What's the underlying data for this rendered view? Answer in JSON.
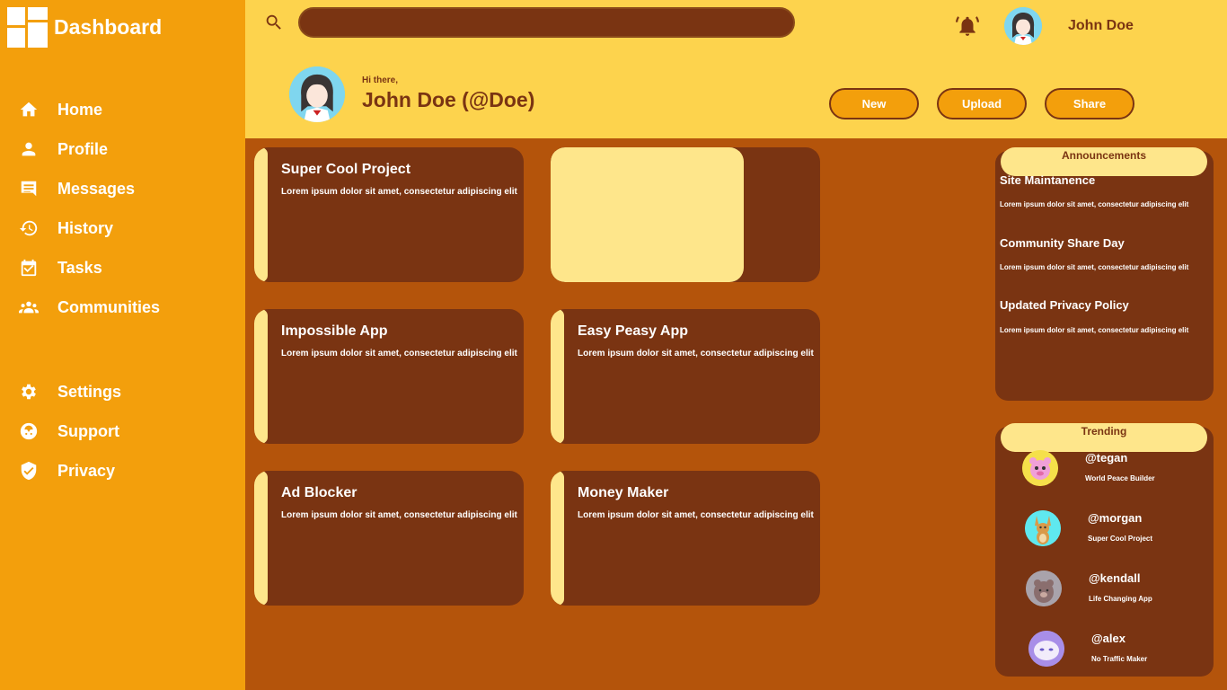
{
  "brand": {
    "title": "Dashboard"
  },
  "sidebar": {
    "items": [
      {
        "label": "Home",
        "icon": "home-icon"
      },
      {
        "label": "Profile",
        "icon": "person-icon"
      },
      {
        "label": "Messages",
        "icon": "messages-icon"
      },
      {
        "label": "History",
        "icon": "history-icon"
      },
      {
        "label": "Tasks",
        "icon": "tasks-icon"
      },
      {
        "label": "Communities",
        "icon": "communities-icon"
      },
      {
        "label": "Settings",
        "icon": "gear-icon"
      },
      {
        "label": "Support",
        "icon": "support-icon"
      },
      {
        "label": "Privacy",
        "icon": "shield-icon"
      }
    ]
  },
  "header": {
    "search": {
      "value": "",
      "placeholder": ""
    },
    "user_name": "John Doe",
    "greeting": "Hi there,",
    "full_name": "John Doe (@Doe)",
    "buttons": [
      "New",
      "Upload",
      "Share"
    ]
  },
  "projects": [
    {
      "title": "Super Cool Project",
      "desc": "Lorem ipsum dolor sit amet, consectetur adipiscing elit"
    },
    {
      "title": "",
      "desc": ""
    },
    {
      "title": "Impossible App",
      "desc": "Lorem ipsum dolor sit amet, consectetur adipiscing elit"
    },
    {
      "title": "Easy Peasy App",
      "desc": "Lorem ipsum dolor sit amet, consectetur adipiscing elit"
    },
    {
      "title": "Ad Blocker",
      "desc": "Lorem ipsum dolor sit amet, consectetur adipiscing elit"
    },
    {
      "title": "Money Maker",
      "desc": "Lorem ipsum dolor sit amet, consectetur adipiscing elit"
    }
  ],
  "announcements": {
    "title": "Announcements",
    "items": [
      {
        "title": "Site Maintanence",
        "desc": "Lorem ipsum dolor sit amet, consectetur adipiscing elit"
      },
      {
        "title": "Community Share Day",
        "desc": "Lorem ipsum dolor sit amet, consectetur adipiscing elit"
      },
      {
        "title": "Updated Privacy Policy",
        "desc": "Lorem ipsum dolor sit amet, consectetur adipiscing elit"
      }
    ]
  },
  "trending": {
    "title": "Trending",
    "items": [
      {
        "handle": "@tegan",
        "project": "World Peace Builder"
      },
      {
        "handle": "@morgan",
        "project": "Super Cool Project"
      },
      {
        "handle": "@kendall",
        "project": "Life Changing App"
      },
      {
        "handle": "@alex",
        "project": "No Traffic Maker"
      }
    ]
  },
  "colors": {
    "sidebar": "#f39f0c",
    "header": "#fdd34d",
    "background": "#b4540b",
    "card": "#7a3412",
    "accent": "#fee68b"
  }
}
